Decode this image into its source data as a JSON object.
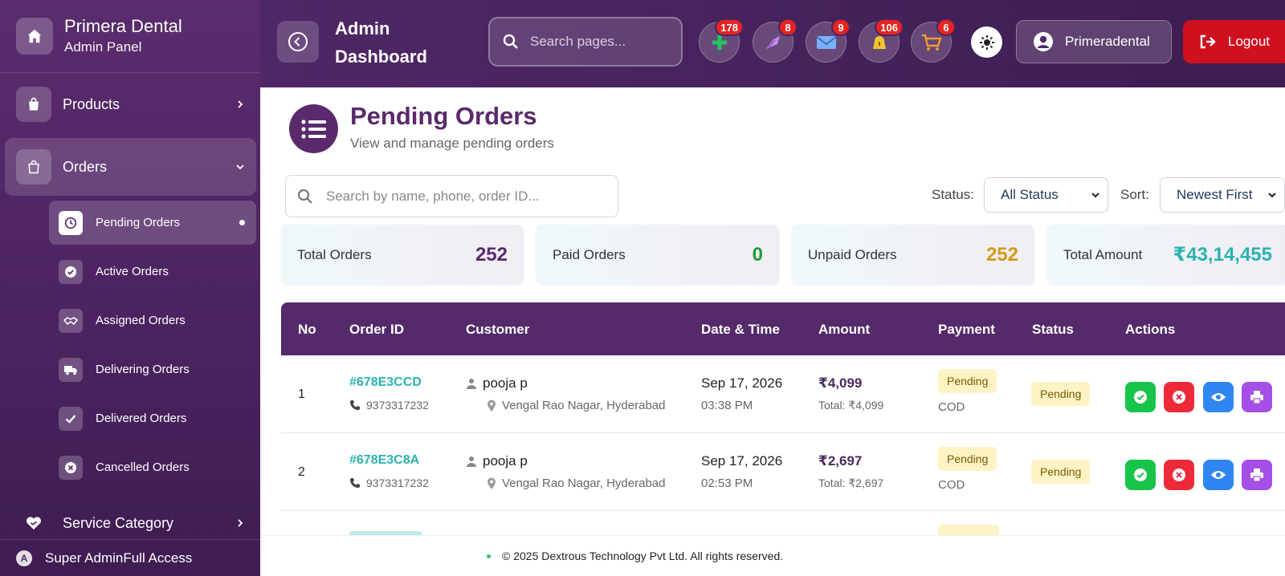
{
  "brand": {
    "title": "Primera Dental",
    "subtitle": "Admin Panel"
  },
  "sidebar": {
    "products": "Products",
    "orders": "Orders",
    "sub_items": [
      "Pending Orders",
      "Active Orders",
      "Assigned Orders",
      "Delivering Orders",
      "Delivered Orders",
      "Cancelled Orders"
    ],
    "service_category": "Service Category",
    "footer_avatar": "A",
    "footer_text": "Super AdminFull Access"
  },
  "header": {
    "title": "Admin Dashboard",
    "search_placeholder": "Search pages...",
    "badges": {
      "plus": "178",
      "dental": "8",
      "mail": "9",
      "bell": "106",
      "cart": "6"
    },
    "user": "Primeradental",
    "logout": "Logout"
  },
  "page": {
    "title": "Pending Orders",
    "subtitle": "View and manage pending orders"
  },
  "filters": {
    "search_placeholder": "Search by name, phone, order ID...",
    "status_label": "Status:",
    "status_value": "All Status",
    "sort_label": "Sort:",
    "sort_value": "Newest First"
  },
  "stats": [
    {
      "label": "Total Orders",
      "value": "252",
      "color": "#5a2a6c"
    },
    {
      "label": "Paid Orders",
      "value": "0",
      "color": "#1f9d3a"
    },
    {
      "label": "Unpaid Orders",
      "value": "252",
      "color": "#d39a12"
    },
    {
      "label": "Total Amount",
      "value": "₹43,14,455",
      "color": "#2ab3b1"
    }
  ],
  "table": {
    "headers": [
      "No",
      "Order ID",
      "Customer",
      "Date & Time",
      "Amount",
      "Payment",
      "Status",
      "Actions"
    ],
    "rows": [
      {
        "no": "1",
        "order_id": "#678E3CCD",
        "phone": "9373317232",
        "customer": "pooja p",
        "location": "Vengal Rao Nagar, Hyderabad",
        "date": "Sep 17, 2026",
        "time": "03:38 PM",
        "amount": "₹4,099",
        "total": "Total: ₹4,099",
        "payment_status": "Pending",
        "payment_method": "COD",
        "status": "Pending"
      },
      {
        "no": "2",
        "order_id": "#678E3C8A",
        "phone": "9373317232",
        "customer": "pooja p",
        "location": "Vengal Rao Nagar, Hyderabad",
        "date": "Sep 17, 2026",
        "time": "02:53 PM",
        "amount": "₹2,697",
        "total": "Total: ₹2,697",
        "payment_status": "Pending",
        "payment_method": "COD",
        "status": "Pending"
      }
    ]
  },
  "footer": "© 2025 Dextrous Technology Pvt Ltd. All rights reserved.",
  "colors": {
    "sidebar": "#4d2462",
    "header": "#4f2766",
    "accent": "#5a2a6c",
    "logout": "#d0101f",
    "badge": "#e52521",
    "approve": "#16c44a",
    "reject": "#ee2a3a",
    "view": "#2f86f0",
    "print": "#a64fe6"
  }
}
